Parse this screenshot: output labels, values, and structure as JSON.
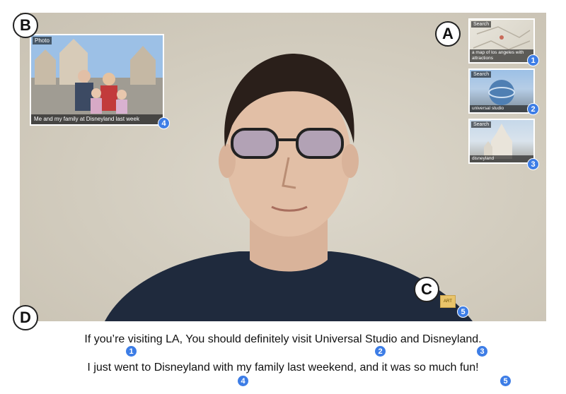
{
  "labels": {
    "a": "A",
    "b": "B",
    "c": "C",
    "d": "D"
  },
  "photo": {
    "tag": "Photo",
    "caption": "Me and my family at Disneyland last week",
    "badge": "4"
  },
  "cards": [
    {
      "tag": "Search",
      "caption": "a map of los angeles with attractions",
      "badge": "1"
    },
    {
      "tag": "Search",
      "caption": "universal studio",
      "badge": "2"
    },
    {
      "tag": "Search",
      "caption": "disneyland",
      "badge": "3"
    }
  ],
  "mini_card": {
    "text": "ART",
    "badge": "5"
  },
  "captions": {
    "line1": "If you’re visiting LA, You should definitely visit Universal Studio and Disneyland.",
    "line2": "I just went to Disneyland with my family last weekend, and it was so much fun!",
    "badges": [
      "1",
      "2",
      "3",
      "4",
      "5"
    ]
  },
  "colors": {
    "badge": "#3d7de6",
    "background": "#d2ccbe",
    "shirt": "#1f2a3d"
  }
}
